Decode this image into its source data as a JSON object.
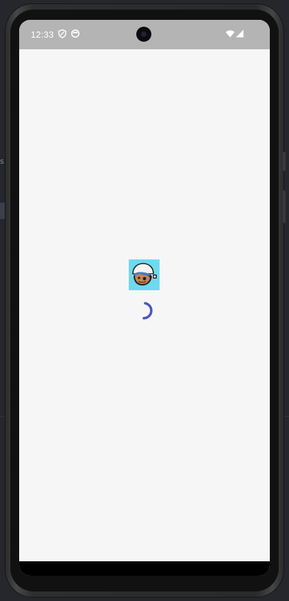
{
  "status_bar": {
    "time": "12:33",
    "icons": [
      "shield-icon",
      "notification-icon",
      "wifi-icon",
      "signal-icon"
    ]
  },
  "splash": {
    "logo_icon": "astronaut-avatar-icon",
    "loading_indicator": "progress-spinner",
    "accent_color": "#4a55c6",
    "logo_background": "#6fd9ee"
  },
  "colors": {
    "screen_background": "#f6f6f6",
    "status_bar_background": "#b4b4b4",
    "nav_bar_background": "#000000"
  }
}
